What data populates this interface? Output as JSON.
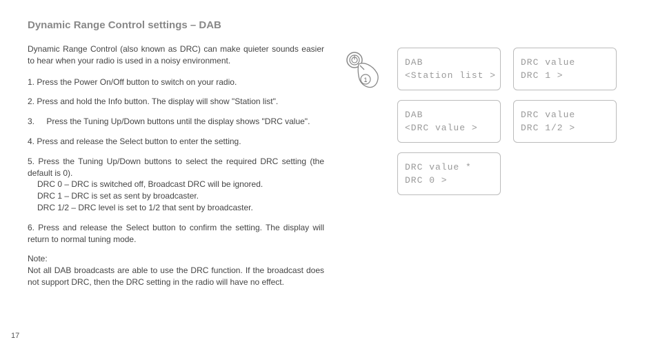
{
  "title": "Dynamic Range Control settings – DAB",
  "intro": "Dynamic Range Control (also known as DRC) can make quieter sounds easier to hear when your radio is used in a noisy environment.",
  "steps": [
    {
      "n": "1.",
      "text": "Press the Power On/Off button to switch on your radio."
    },
    {
      "n": "2.",
      "text": "Press and hold the Info button. The display will show \"Station list\"."
    },
    {
      "n": "3.",
      "text": "Press the Tuning Up/Down buttons until the display shows \"DRC value\"."
    },
    {
      "n": "4.",
      "text": "Press and release the Select button to enter the setting."
    },
    {
      "n": "5.",
      "text": "Press the Tuning Up/Down buttons to select the required DRC setting (the default is 0).",
      "subs": [
        "DRC 0 – DRC is switched off, Broadcast DRC will be ignored.",
        "DRC 1 – DRC is set as sent by broadcaster.",
        "DRC 1/2 – DRC level is set to 1/2 that sent by broadcaster."
      ]
    },
    {
      "n": "6.",
      "text": "Press and release the Select button to confirm the setting. The display will return to normal tuning mode."
    }
  ],
  "note_title": "Note:",
  "note": "Not all DAB broadcasts are able to use the DRC function. If the broadcast does not support DRC, then the DRC setting in the radio will have no effect.",
  "page_number": "17",
  "hand_badge": "1",
  "screens": [
    {
      "line1": "DAB",
      "line2": "<Station list  >"
    },
    {
      "line1": "DRC value",
      "line2": "DRC 1          >"
    },
    {
      "line1": "DAB",
      "line2": "<DRC value     >"
    },
    {
      "line1": "DRC value",
      "line2": "DRC 1/2        >"
    },
    {
      "line1": "DRC value    *",
      "line2": "DRC 0          >"
    }
  ]
}
